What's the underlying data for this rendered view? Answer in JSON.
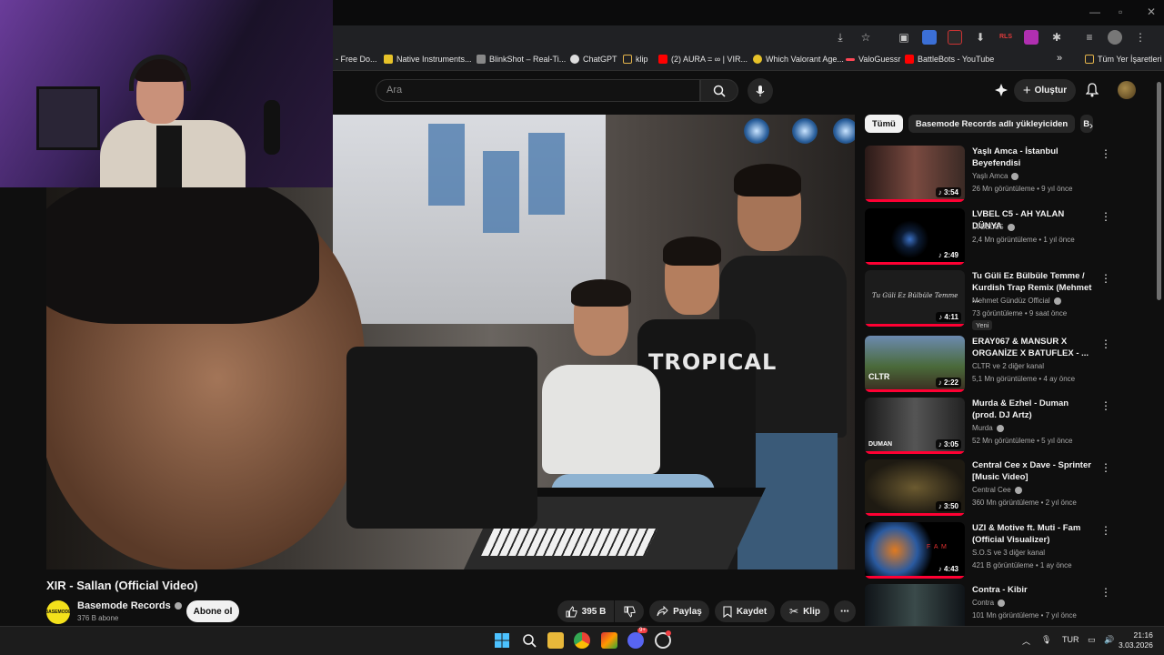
{
  "bookmarks": [
    {
      "label": "- Free Do...",
      "color": "#4c8bf5"
    },
    {
      "label": "Native Instruments...",
      "color": "#e6c229"
    },
    {
      "label": "BlinkShot – Real-Ti...",
      "color": "#888888"
    },
    {
      "label": "ChatGPT",
      "color": "#dddddd"
    },
    {
      "label": "klip",
      "color": "#e3b34b"
    },
    {
      "label": "(2) AURA = ∞ | VIR...",
      "color": "#ff0000"
    },
    {
      "label": "Which Valorant Age...",
      "color": "#e6c229"
    },
    {
      "label": "ValoGuessr",
      "color": "#ff4655"
    },
    {
      "label": "BattleBots - YouTube",
      "color": "#ff0000"
    },
    {
      "label": "»",
      "color": ""
    },
    {
      "label": "Tüm Yer İşaretleri",
      "color": "#e3b34b"
    }
  ],
  "header": {
    "search_placeholder": "Ara",
    "create_label": "Oluştur"
  },
  "video": {
    "shirt_text": "TROPICAL",
    "title": "XIR - Sallan (Official Video)",
    "channel_name": "Basemode Records",
    "channel_avatar_text": "BASEMODE",
    "subscribers": "376 B abone",
    "subscribe_label": "Abone ol",
    "likes": "395 B",
    "share_label": "Paylaş",
    "save_label": "Kaydet",
    "clip_label": "Klip"
  },
  "chips": [
    {
      "label": "Tümü",
      "active": true
    },
    {
      "label": "Basemode Records adlı yükleyiciden",
      "active": false
    },
    {
      "label": "B",
      "active": false
    }
  ],
  "recommendations": [
    {
      "title": "Yaşlı Amca - İstanbul Beyefendisi",
      "channel": "Yaşlı Amca",
      "meta": "26 Mn görüntüleme • 9 yıl önce",
      "duration": "3:54",
      "badge": ""
    },
    {
      "title": "LVBEL C5 - AH YALAN DÜNYA",
      "channel": "LVBELC5",
      "meta": "2,4 Mn görüntüleme • 1 yıl önce",
      "duration": "2:49",
      "badge": ""
    },
    {
      "title": "Tu Güli Ez Bülbüle Temme / Kurdish Trap Remix (Mehmet ...",
      "channel": "Mehmet Gündüz Official",
      "meta": "73 görüntüleme • 9 saat önce",
      "duration": "4:11",
      "badge": "Yeni",
      "thumb_text": "Tu Güli Ez Bülbüle Temme"
    },
    {
      "title": "ERAY067 & MANSUR X ORGANİZE X BATUFLEX - ...",
      "channel": "CLTR ve 2 diğer kanal",
      "meta": "5,1 Mn görüntüleme • 4 ay önce",
      "duration": "2:22",
      "badge": "",
      "thumb_text": "CLTR"
    },
    {
      "title": "Murda & Ezhel - Duman (prod. DJ Artz)",
      "channel": "Murda",
      "meta": "52 Mn görüntüleme • 5 yıl önce",
      "duration": "3:05",
      "badge": "",
      "thumb_text": "DUMAN"
    },
    {
      "title": "Central Cee x Dave - Sprinter [Music Video]",
      "channel": "Central Cee",
      "meta": "360 Mn görüntüleme • 2 yıl önce",
      "duration": "3:50",
      "badge": ""
    },
    {
      "title": "UZI & Motive ft. Muti - Fam (Official Visualizer)",
      "channel": "S.O.S ve 3 diğer kanal",
      "meta": "421 B görüntüleme • 1 ay önce",
      "duration": "4:43",
      "badge": "",
      "thumb_text": "F A M"
    },
    {
      "title": "Contra - Kibir",
      "channel": "Contra",
      "meta": "101 Mn görüntüleme • 7 yıl önce",
      "duration": "",
      "badge": ""
    }
  ],
  "taskbar": {
    "discord_badge": "9+",
    "language": "TUR",
    "time": "21:16",
    "date": "3.03.2026"
  }
}
